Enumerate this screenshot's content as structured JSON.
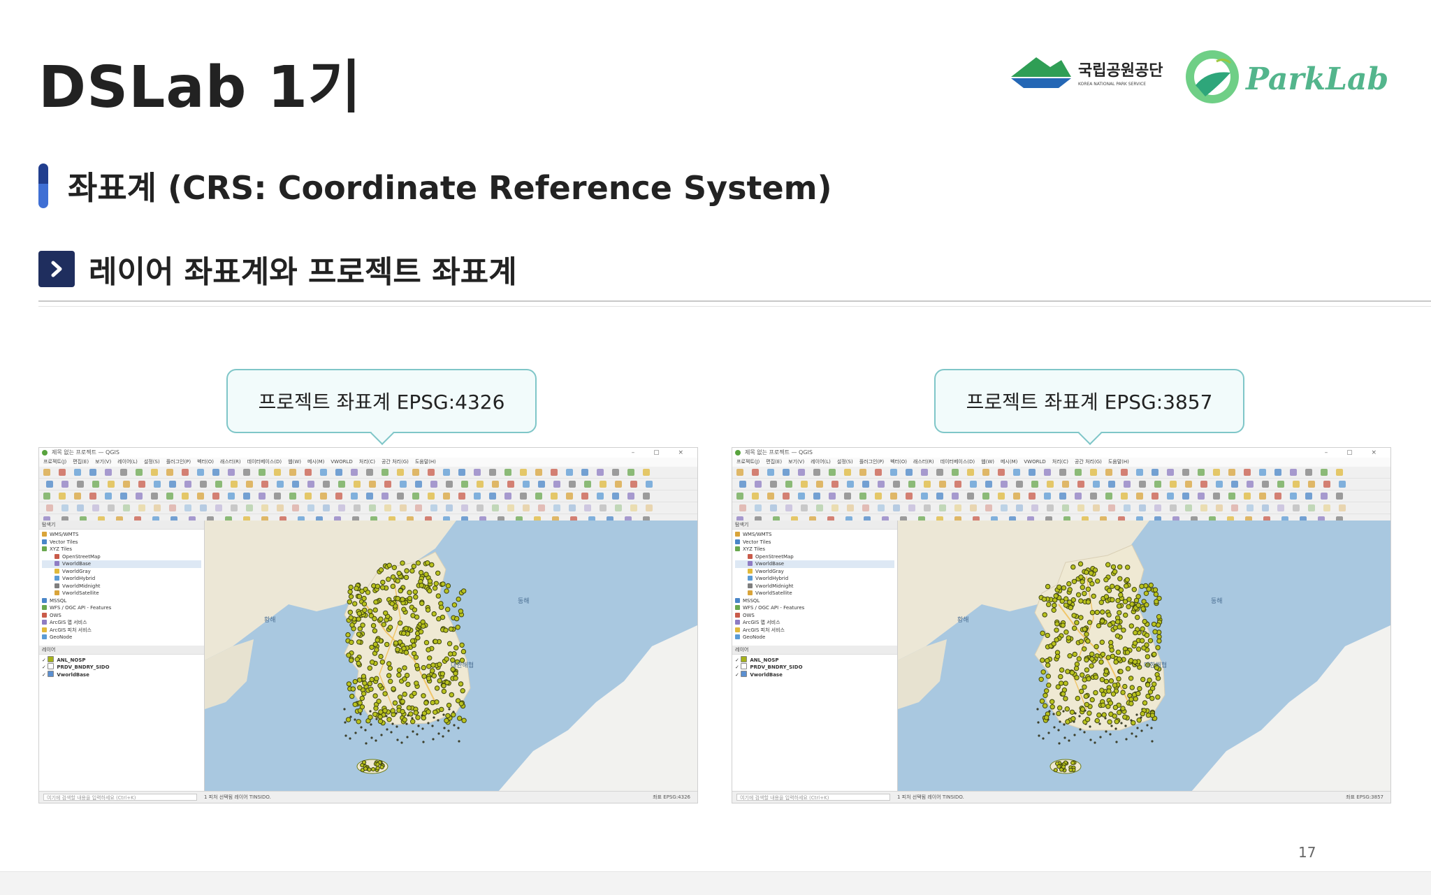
{
  "slide": {
    "title": "DSLab 1기",
    "section_title": "좌표계 (CRS: Coordinate Reference System)",
    "subsection_title": "레이어 좌표계와 프로젝트 좌표계",
    "page_number": "17"
  },
  "logos": {
    "knps_name": "국립공원공단",
    "knps_subtitle": "KOREA NATIONAL PARK SERVICE",
    "parklab_text": "ParkLab"
  },
  "panels": [
    {
      "callout": "프로젝트 좌표계 EPSG:4326",
      "window_title": "제목 없는 프로젝트 — QGIS",
      "browser_label": "탐색기",
      "layers_label": "레이어",
      "browser_items": [
        "WMS/WMTS",
        "Vector Tiles",
        "XYZ Tiles",
        "OpenStreetMap",
        "VworldBase",
        "VworldGray",
        "VworldHybrid",
        "VworldMidnight",
        "VworldSatellite",
        "MSSQL",
        "WFS / OGC API - Features",
        "OWS",
        "ArcGIS 맵 서비스",
        "ArcGIS 피처 서비스",
        "GeoNode"
      ],
      "layers": [
        "ANL_NOSP",
        "PRDV_BNDRY_SIDO",
        "VworldBase"
      ],
      "status_left": "여기에 검색할 내용을 입력하세요 (Ctrl+K)",
      "status_mid": "1 피처 선택됨 레이어 TINSIDO.",
      "status_right": "좌표 EPSG:4326"
    },
    {
      "callout": "프로젝트 좌표계 EPSG:3857",
      "window_title": "제목 없는 프로젝트 — QGIS",
      "browser_label": "탐색기",
      "layers_label": "레이어",
      "browser_items": [
        "WMS/WMTS",
        "Vector Tiles",
        "XYZ Tiles",
        "OpenStreetMap",
        "VworldBase",
        "VworldGray",
        "VworldHybrid",
        "VworldMidnight",
        "VworldSatellite",
        "MSSQL",
        "WFS / OGC API - Features",
        "OWS",
        "ArcGIS 맵 서비스",
        "ArcGIS 피처 서비스",
        "GeoNode"
      ],
      "layers": [
        "ANL_NOSP",
        "PRDV_BNDRY_SIDO",
        "VworldBase"
      ],
      "status_left": "여기에 검색할 내용을 입력하세요 (Ctrl+K)",
      "status_mid": "1 피처 선택됨 레이어 TINSIDO.",
      "status_right": "좌표 EPSG:3857"
    }
  ],
  "menu_items": [
    "프로젝트(J)",
    "편집(E)",
    "보기(V)",
    "레이어(L)",
    "설정(S)",
    "플러그인(P)",
    "벡터(O)",
    "래스터(R)",
    "데이터베이스(D)",
    "웹(W)",
    "메시(M)",
    "VWORLD",
    "처리(C)",
    "공간 처리(G)",
    "도움말(H)"
  ],
  "map_labels": {
    "sea_east": "동해",
    "sea_yellow": "황해",
    "sea_strait": "대한해협"
  },
  "colors": {
    "title_text": "#222222",
    "section_bar_dark": "#213e8e",
    "section_bar_light": "#3f6fd4",
    "subsection_box": "#1f2e5e",
    "callout_border": "#7fc6c8",
    "sea": "#a9c8e0",
    "land": "#ece7d6",
    "point_fill": "#a6b21c"
  }
}
